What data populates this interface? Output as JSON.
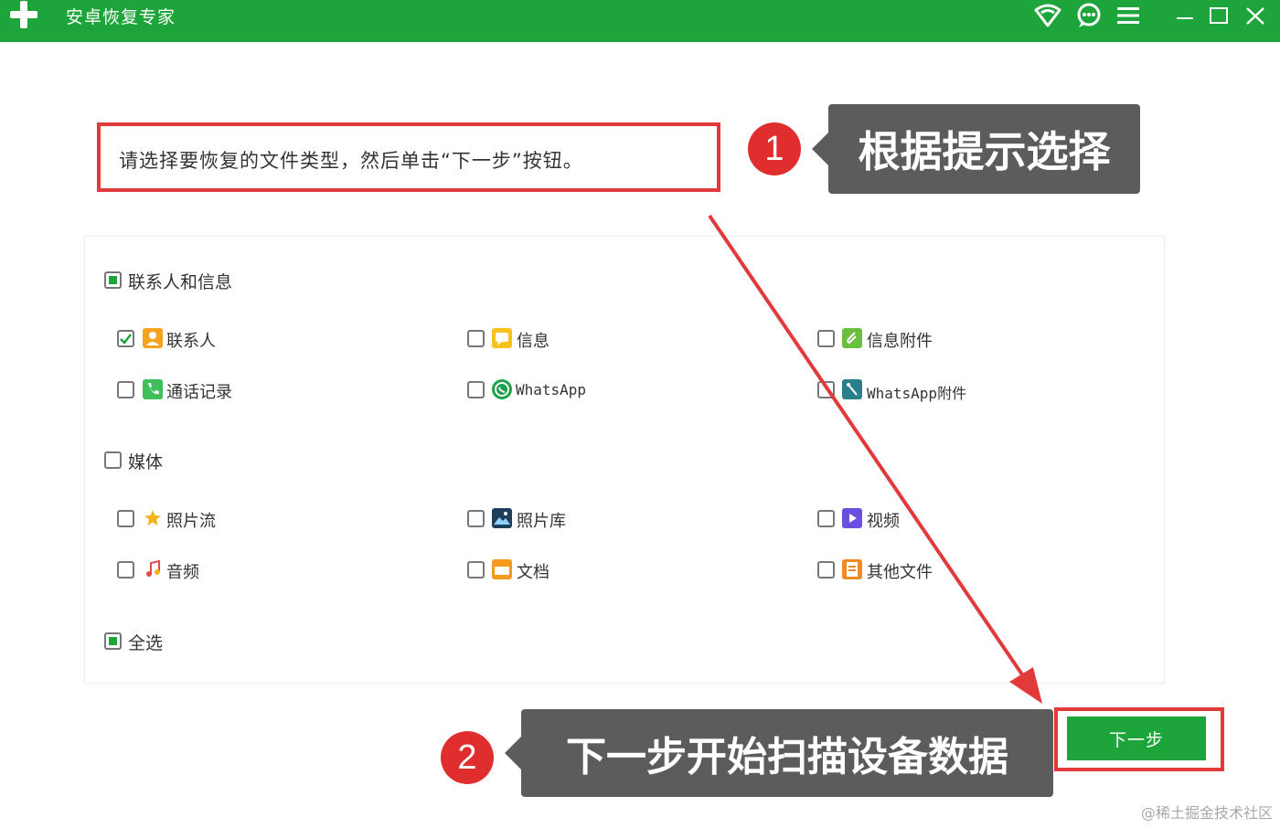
{
  "window": {
    "title": "安卓恢复专家",
    "icons": [
      "wifi-icon",
      "chat-icon",
      "menu-icon",
      "minimize-icon",
      "maximize-icon",
      "close-icon"
    ]
  },
  "instruction": "请选择要恢复的文件类型，然后单击“下一步”按钮。",
  "callouts": {
    "step1": {
      "number": "1",
      "text": "根据提示选择"
    },
    "step2": {
      "number": "2",
      "text": "下一步开始扫描设备数据"
    }
  },
  "groups": {
    "contacts_messages": {
      "label": "联系人和信息",
      "state": "partial",
      "items": [
        {
          "label": "联系人",
          "checked": true,
          "icon": "contacts-icon"
        },
        {
          "label": "信息",
          "checked": false,
          "icon": "messages-icon"
        },
        {
          "label": "信息附件",
          "checked": false,
          "icon": "message-attachment-icon"
        },
        {
          "label": "通话记录",
          "checked": false,
          "icon": "call-log-icon"
        },
        {
          "label": "WhatsApp",
          "checked": false,
          "icon": "whatsapp-icon"
        },
        {
          "label": "WhatsApp附件",
          "checked": false,
          "icon": "whatsapp-attachment-icon"
        }
      ]
    },
    "media": {
      "label": "媒体",
      "state": "unchecked",
      "items": [
        {
          "label": "照片流",
          "checked": false,
          "icon": "photo-stream-icon"
        },
        {
          "label": "照片库",
          "checked": false,
          "icon": "photo-library-icon"
        },
        {
          "label": "视频",
          "checked": false,
          "icon": "video-icon"
        },
        {
          "label": "音频",
          "checked": false,
          "icon": "audio-icon"
        },
        {
          "label": "文档",
          "checked": false,
          "icon": "document-icon"
        },
        {
          "label": "其他文件",
          "checked": false,
          "icon": "other-files-icon"
        }
      ]
    },
    "select_all": {
      "label": "全选",
      "state": "partial"
    }
  },
  "next_button": {
    "label": "下一步"
  },
  "watermark": "@稀土掘金技术社区",
  "colors": {
    "brand_green": "#1da43a",
    "annotation_red": "#e23a3a",
    "callout_gray": "#5c5c5c"
  }
}
